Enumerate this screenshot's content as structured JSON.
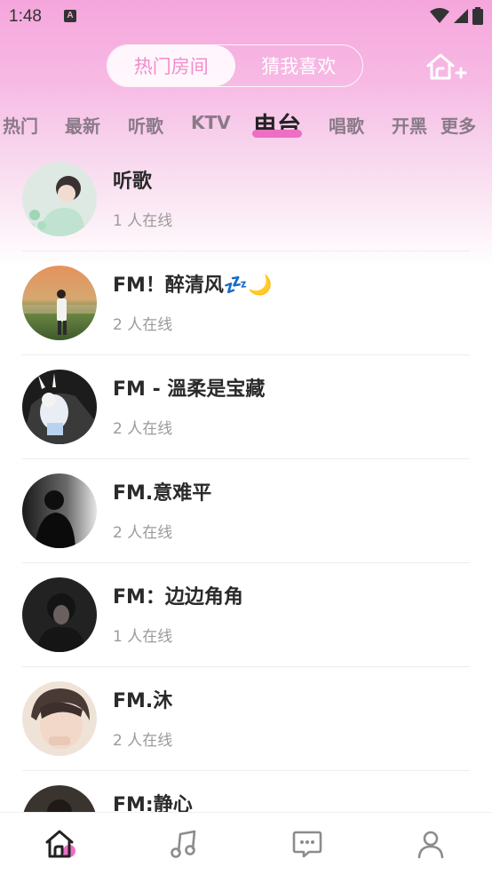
{
  "status_bar": {
    "time": "1:48"
  },
  "header": {
    "tabs": [
      {
        "label": "热门房间",
        "active": true
      },
      {
        "label": "猜我喜欢",
        "active": false
      }
    ],
    "create_room_icon": "house-plus-icon"
  },
  "categories": {
    "items": [
      "热门",
      "最新",
      "听歌",
      "KTV",
      "电台",
      "唱歌",
      "开黑"
    ],
    "active": "电台",
    "more_label": "更多"
  },
  "rooms": [
    {
      "name": "听歌",
      "online": "1 人在线"
    },
    {
      "name": "FM！醉清风💤🌙",
      "online": "2 人在线"
    },
    {
      "name": "FM - 溫柔是宝藏",
      "online": "2 人在线"
    },
    {
      "name": "FM.意难平",
      "online": "2 人在线"
    },
    {
      "name": "FM：边边角角",
      "online": "1 人在线"
    },
    {
      "name": "FM.沐",
      "online": "2 人在线"
    },
    {
      "name": "FM:静心",
      "online": ""
    }
  ],
  "bottom_nav": [
    {
      "icon": "home-icon",
      "active": true
    },
    {
      "icon": "music-note-icon",
      "active": false
    },
    {
      "icon": "message-icon",
      "active": false
    },
    {
      "icon": "profile-icon",
      "active": false
    }
  ],
  "colors": {
    "accent": "#ec6fc3",
    "active_tab_text": "#f38ccb"
  }
}
